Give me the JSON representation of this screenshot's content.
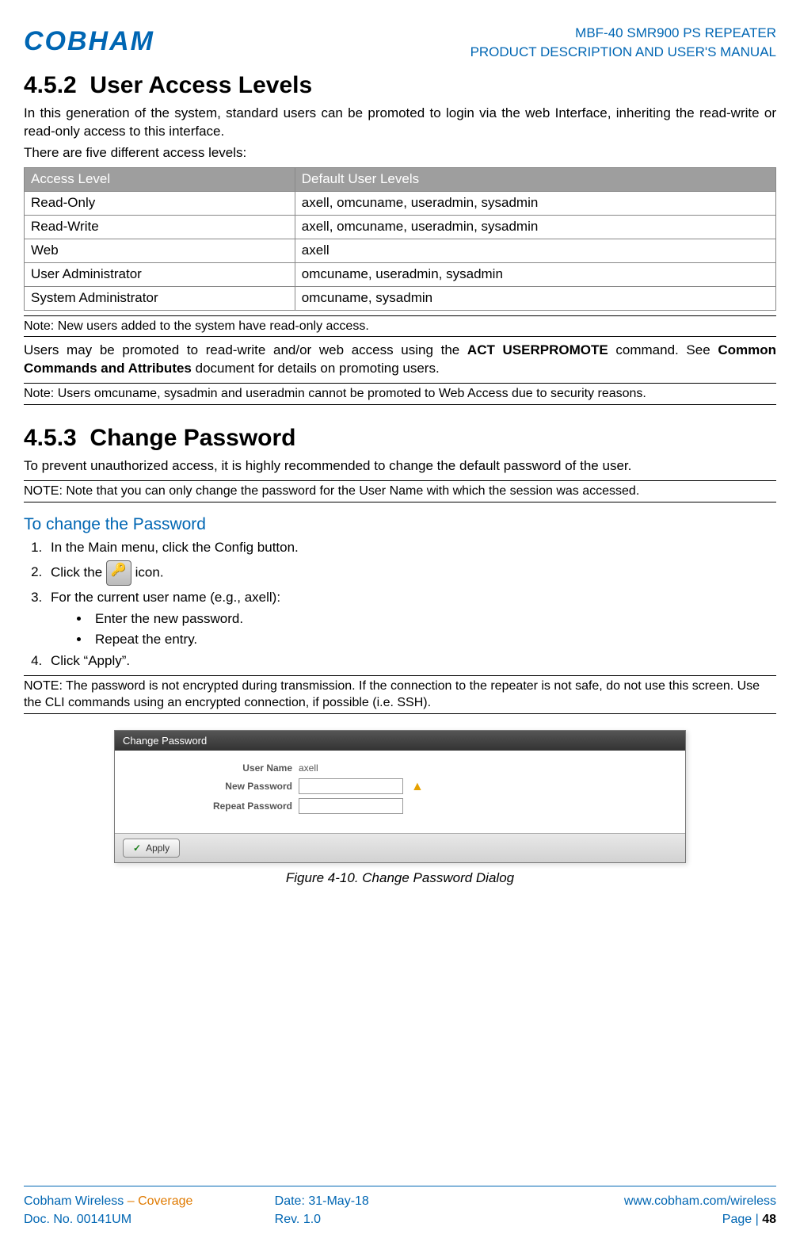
{
  "brand": "COBHAM",
  "doc_header": {
    "line1": "MBF-40 SMR900 PS REPEATER",
    "line2": "PRODUCT DESCRIPTION AND USER'S MANUAL"
  },
  "section_452": {
    "number": "4.5.2",
    "title": "User Access Levels",
    "intro1": "In this generation of the system, standard users can be promoted to login via the web Interface, inheriting the read-write or read-only access to this interface.",
    "intro2": "There are five different access levels:",
    "table": {
      "head": [
        "Access Level",
        "Default User Levels"
      ],
      "rows": [
        [
          "Read-Only",
          "axell, omcuname, useradmin, sysadmin"
        ],
        [
          "Read-Write",
          "axell, omcuname, useradmin, sysadmin"
        ],
        [
          "Web",
          "axell"
        ],
        [
          "User Administrator",
          "omcuname, useradmin, sysadmin"
        ],
        [
          "System Administrator",
          "omcuname, sysadmin"
        ]
      ]
    },
    "note1": "Note: New users added to the system have read-only access.",
    "promote_pre": "Users may be promoted to read-write and/or web access using the ",
    "promote_cmd": "ACT USERPROMOTE",
    "promote_mid": " command. See ",
    "promote_doc": "Common Commands and Attributes",
    "promote_post": " document for details on promoting users.",
    "note2": "Note: Users omcuname, sysadmin and useradmin cannot be promoted to Web Access due to security reasons."
  },
  "section_453": {
    "number": "4.5.3",
    "title": "Change Password",
    "intro": "To prevent unauthorized access, it is highly recommended to change the default password of the user.",
    "note1": "NOTE: Note that you can only change the password for the User Name with which the session was accessed.",
    "subhead": "To change the Password",
    "steps": {
      "s1": "In the Main menu, click the Config button.",
      "s2_pre": "Click the ",
      "s2_post": " icon.",
      "s3": "For the current user name (e.g., axell):",
      "s3a": "Enter the new password.",
      "s3b": "Repeat the entry.",
      "s4": "Click “Apply”."
    },
    "note2": "NOTE: The password is not encrypted during transmission. If the connection to the repeater is not safe, do not use this screen. Use the CLI commands using an encrypted connection, if possible (i.e. SSH)."
  },
  "dialog": {
    "title": "Change Password",
    "user_label": "User Name",
    "user_value": "axell",
    "new_label": "New Password",
    "repeat_label": "Repeat Password",
    "apply": "Apply"
  },
  "figure_caption": "Figure 4-10. Change Password Dialog",
  "footer": {
    "company_pre": "Cobham Wireless",
    "company_sep": " – ",
    "company_post": "Coverage",
    "date_label": "Date: ",
    "date": "31-May-18",
    "url": "www.cobham.com/wireless",
    "docno": "Doc. No. 00141UM",
    "rev": "Rev. 1.0",
    "page_label": "Page | ",
    "page_num": "48"
  }
}
